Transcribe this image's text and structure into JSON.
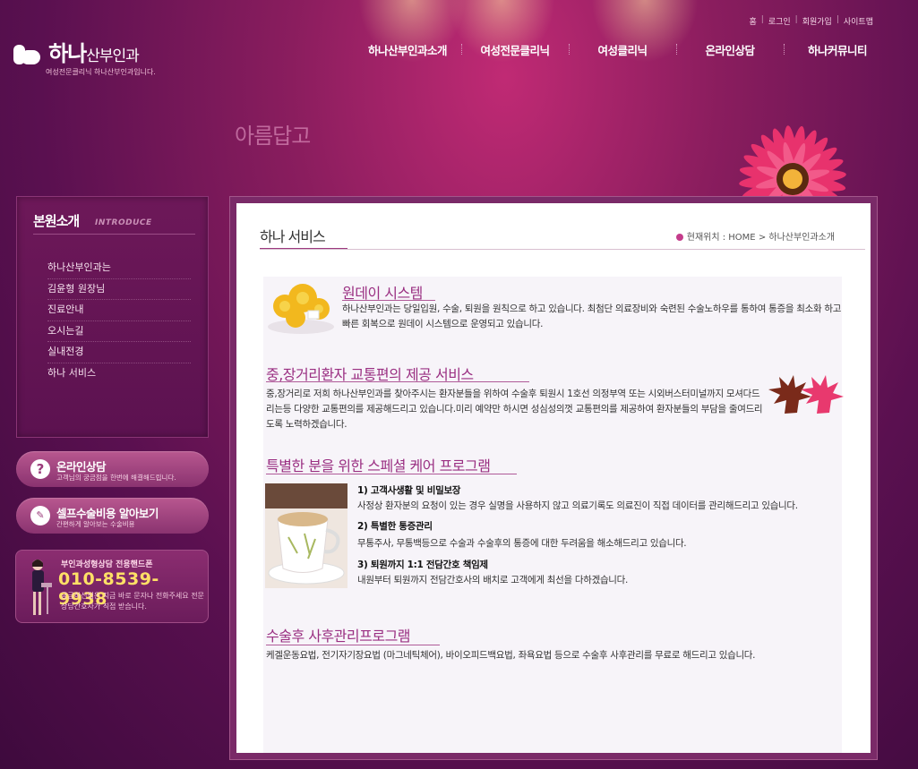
{
  "util_links": [
    "홈",
    "로그인",
    "회원가입",
    "사이트맵"
  ],
  "logo": {
    "name_main": "하나",
    "name_sub": "산부인과",
    "tagline": "여성전문클리닉 하나산부인과입니다."
  },
  "gnb": [
    "하나산부인과소개",
    "여성전문클리닉",
    "여성클리닉",
    "온라인상담",
    "하나커뮤니티"
  ],
  "slogan": "아름답고",
  "lnb": {
    "title": "본원소개",
    "title_eng": "INTRODUCE",
    "items": [
      "하나산부인과는",
      "김윤형 원장님",
      "진료안내",
      "오시는길",
      "실내전경",
      "하나 서비스"
    ]
  },
  "banners": {
    "consult": {
      "title": "온라인상담",
      "sub": "고객님의 궁금점을 한번에 해결해드립니다."
    },
    "cost": {
      "title": "셀프수술비용 알아보기",
      "sub": "간편하게 알아보는 수술비용"
    },
    "phone": {
      "label": "부인과성형상담 전용핸드폰",
      "number": "010-8539-9938",
      "desc": "궁금하신점은 지금 바로 문자나 전화주세요 전문상담간호사가 직접 받습니다."
    }
  },
  "content": {
    "title": "하나 서비스",
    "location_prefix": "현재위치 : HOME",
    "location_current": "하나산부인과소개",
    "sections": [
      {
        "title": "원데이 시스템",
        "text": "하나산부인과는 당일입원, 수술, 퇴원을 원칙으로 하고 있습니다.  최첨단 의료장비와 숙련된 수술노하우를 통하여 통증을 최소화 하고 빠른 회복으로 원데이 시스템으로 운영되고 있습니다."
      },
      {
        "title": "중,장거리환자 교통편의 제공 서비스",
        "text": "중,장거리로 저희 하나산부인과를 찾아주시는 환자분들을 위하여 수술후 퇴원시 1호선 의정부역 또는 시외버스터미널까지 모셔다드리는등 다양한 교통편의를 제공해드리고 있습니다.미리 예약만 하시면 성심성의껏 교통편의를 제공하여 환자분들의 부담을 줄여드리도록 노력하겠습니다."
      },
      {
        "title": "특별한 분을 위한 스페셜 케어 프로그램",
        "items": [
          {
            "head": "1) 고객사생활 및 비밀보장",
            "text": "사정상 환자분의 요청이 있는 경우 실명을 사용하지 않고 의료기록도 의료진이 직접 데이터를 관리해드리고 있습니다."
          },
          {
            "head": "2) 특별한 통증관리",
            "text": "무통주사, 무통백등으로 수술과 수술후의 통증에 대한 두려움을 해소해드리고 있습니다."
          },
          {
            "head": "3) 퇴원까지 1:1 전담간호 책임제",
            "text": "내원부터 퇴원까지 전담간호사의 배치로 고객에게 최선을 다하겠습니다."
          }
        ]
      },
      {
        "title": "수술후 사후관리프로그램",
        "text": "케겔운동요법, 전기자기장요법 (마그네틱체어), 바이오피드백요법, 좌욕요법 등으로 수술후 사후관리를 무료로 해드리고 있습니다."
      }
    ]
  },
  "colors": {
    "bg_dark": "#5a1050",
    "accent": "#9a2f82",
    "phone_number": "#ffe066"
  }
}
